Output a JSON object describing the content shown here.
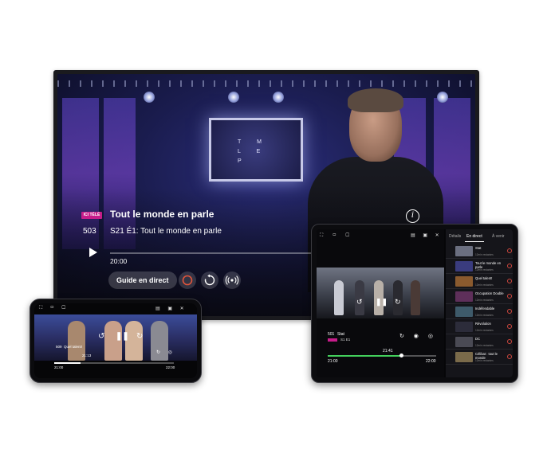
{
  "tv": {
    "logo_letters": "T M L E P",
    "network_badge": "ICI TÉLÉ",
    "title": "Tout le monde en parle",
    "channel_number": "503",
    "episode": "S21 É1: Tout le monde en parle",
    "time": "20:00",
    "progress": 0.0,
    "guide_button": "Guide en direct",
    "info_icon": "info-icon",
    "play_icon": "play-icon",
    "record_icon": "record-icon",
    "restart_icon": "restart-icon",
    "broadcast_icon": "broadcast-icon",
    "accent_color": "#c71c8a"
  },
  "tablet": {
    "tabs": [
      "Détails",
      "En direct",
      "À venir"
    ],
    "active_tab": "En direct",
    "channel_number": "501",
    "show_name": "Stat",
    "episode": "S1 E1",
    "now_time": "21:41",
    "start_time": "21:00",
    "end_time": "22:00",
    "progress": 0.68,
    "progress_color": "#43d05c",
    "channels": [
      {
        "ch": "",
        "name": "Stat",
        "sub": "12min restantes",
        "color": "#6b6f80"
      },
      {
        "ch": "",
        "name": "Tout le monde en parle",
        "sub": "12min restantes",
        "color": "#3a3c7e"
      },
      {
        "ch": "",
        "name": "Quel talent!",
        "sub": "12min restantes",
        "color": "#8a5a2e"
      },
      {
        "ch": "",
        "name": "Occupation Double",
        "sub": "12min restantes",
        "color": "#5e2f5a"
      },
      {
        "ch": "",
        "name": "Indéfendable",
        "sub": "12min restantes",
        "color": "#3e5a6a"
      },
      {
        "ch": "",
        "name": "Révolution",
        "sub": "12min restantes",
        "color": "#2c2c3a"
      },
      {
        "ch": "",
        "name": "DC",
        "sub": "12min restantes",
        "color": "#4a4a54"
      },
      {
        "ch": "",
        "name": "Célibat : tout le monde",
        "sub": "12min restantes",
        "color": "#7a6a4a"
      }
    ]
  },
  "phone": {
    "channel_number": "509",
    "show_name": "Quel talent!",
    "now_time": "21:13",
    "start_time": "21:00",
    "end_time": "22:00",
    "progress": 0.22
  }
}
